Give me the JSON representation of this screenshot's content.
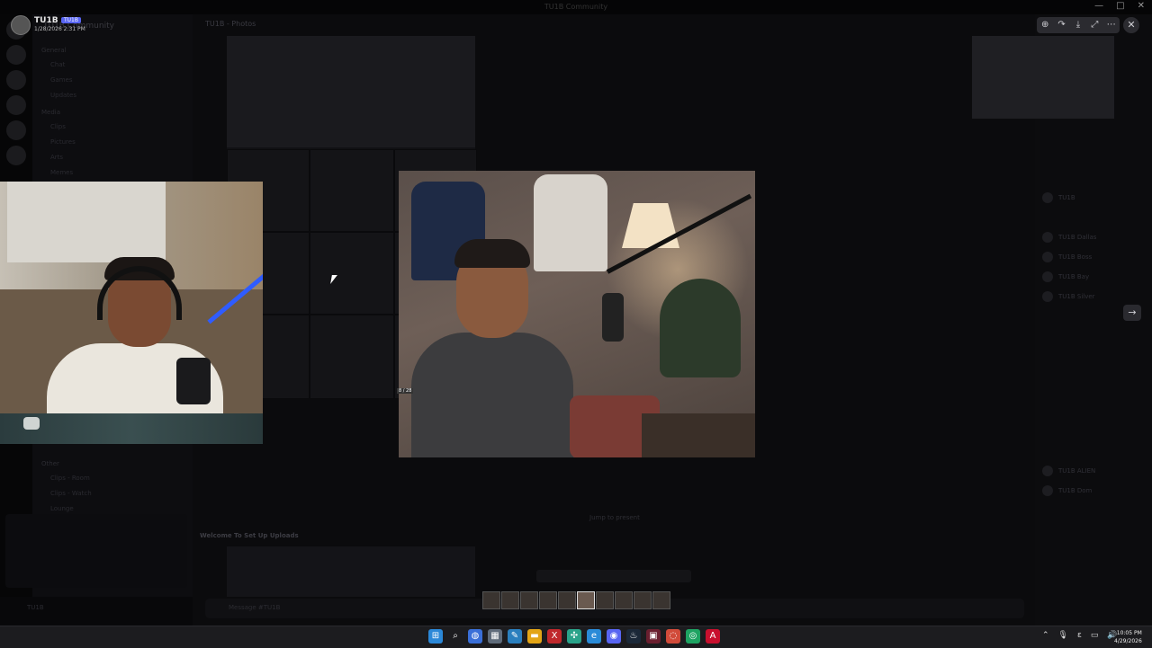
{
  "window": {
    "title": "TU1B Community",
    "min": "—",
    "max": "□",
    "close": "✕"
  },
  "profile": {
    "name": "TU1B",
    "tag": "TU1B",
    "date": "1/28/2026 2:31 PM"
  },
  "server": {
    "name": "TU1B Community"
  },
  "channel_header": "TU1B - Photos",
  "sidebar": {
    "cat1": "General",
    "cat2": "Media",
    "cat3": "Other",
    "channels_top": [
      "Chat",
      "Games",
      "Updates",
      "Clips",
      "Pictures",
      "Arts",
      "Memes"
    ],
    "channels_bottom": [
      "Clips - Room",
      "Clips - Watch",
      "Lounge"
    ]
  },
  "viewer": {
    "toolbar": [
      "⊕",
      "↷",
      "⤓",
      "⤢",
      "⋯"
    ],
    "close_icon": "✕",
    "next_icon": "→",
    "index_label": "8 / 28"
  },
  "messages": {
    "m1": "Welcome To Set Up Uploads",
    "center": "Jump to present"
  },
  "input_placeholder": "Message #TU1B",
  "members": [
    "TU1B",
    "TU1B Dallas",
    "TU1B Boss",
    "TU1B Bay",
    "TU1B Silver",
    "TU1B ALIEN",
    "TU1B Dom"
  ],
  "user_panel": "TU1B",
  "taskbar": {
    "apps": [
      {
        "icon": "⊞",
        "color": "#2b88d8"
      },
      {
        "icon": "⌕",
        "color": "transparent"
      },
      {
        "icon": "◍",
        "color": "#3a6fd8"
      },
      {
        "icon": "▦",
        "color": "#5f6b7a"
      },
      {
        "icon": "✎",
        "color": "#2a7fbe"
      },
      {
        "icon": "▬",
        "color": "#e3a516"
      },
      {
        "icon": "X",
        "color": "#c0282c"
      },
      {
        "icon": "✣",
        "color": "#2aa38a"
      },
      {
        "icon": "e",
        "color": "#2a8bd8"
      },
      {
        "icon": "◉",
        "color": "#5865f2"
      },
      {
        "icon": "♨",
        "color": "#1b2838"
      },
      {
        "icon": "▣",
        "color": "#6a1f2f"
      },
      {
        "icon": "◌",
        "color": "#d14b3a"
      },
      {
        "icon": "◎",
        "color": "#1ea362"
      },
      {
        "icon": "A",
        "color": "#c8102e"
      }
    ],
    "tray": [
      "⌃",
      "🎙",
      "ε",
      "▭",
      "🔊"
    ],
    "time": "10:05 PM",
    "date": "4/29/2026"
  }
}
